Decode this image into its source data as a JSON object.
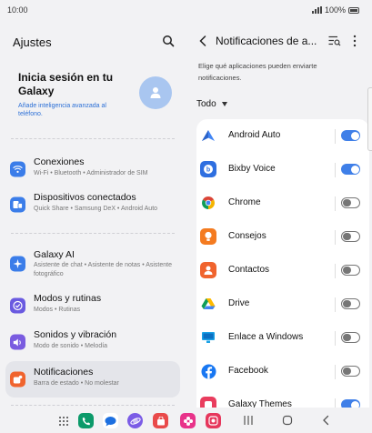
{
  "status": {
    "time": "10:00",
    "battery": "100%"
  },
  "left": {
    "title": "Ajustes",
    "account": {
      "title": "Inicia sesión en tu Galaxy",
      "subtitle": "Añade inteligencia avanzada al teléfono."
    },
    "items": [
      {
        "title": "Conexiones",
        "subtitle": "Wi-Fi  •  Bluetooth  •  Administrador de SIM",
        "icon": "wifi-icon",
        "color": "#3b7de9"
      },
      {
        "title": "Dispositivos conectados",
        "subtitle": "Quick Share  •  Samsung DeX  •  Android Auto",
        "icon": "devices-icon",
        "color": "#3b7de9"
      },
      {
        "title": "Galaxy AI",
        "subtitle": "Asistente de chat  •  Asistente de notas  •  Asistente fotográfico",
        "icon": "sparkle-icon",
        "color": "#3b7de9"
      },
      {
        "title": "Modos y rutinas",
        "subtitle": "Modos  •  Rutinas",
        "icon": "check-circle-icon",
        "color": "#6a5ae0"
      },
      {
        "title": "Sonidos y vibración",
        "subtitle": "Modo de sonido  •  Melodía",
        "icon": "volume-icon",
        "color": "#7a5ce0"
      },
      {
        "title": "Notificaciones",
        "subtitle": "Barra de estado  •  No molestar",
        "icon": "bell-icon",
        "color": "#f0642e"
      }
    ]
  },
  "right": {
    "title": "Notificaciones de a...",
    "description": "Elige qué aplicaciones pueden enviarte notificaciones.",
    "filter": "Todo",
    "apps": [
      {
        "name": "Android Auto",
        "on": true,
        "icon": "android-auto-icon",
        "color": "#ffffff"
      },
      {
        "name": "Bixby Voice",
        "on": true,
        "icon": "bixby-icon",
        "color": "#2f6fe0"
      },
      {
        "name": "Chrome",
        "on": false,
        "icon": "chrome-icon",
        "color": "#ffffff"
      },
      {
        "name": "Consejos",
        "on": false,
        "icon": "tips-icon",
        "color": "#f47b20"
      },
      {
        "name": "Contactos",
        "on": false,
        "icon": "contacts-icon",
        "color": "#f0642e"
      },
      {
        "name": "Drive",
        "on": false,
        "icon": "drive-icon",
        "color": "#ffffff"
      },
      {
        "name": "Enlace a Windows",
        "on": false,
        "icon": "windows-link-icon",
        "color": "#ffffff"
      },
      {
        "name": "Facebook",
        "on": false,
        "icon": "facebook-icon",
        "color": "#1877f2"
      },
      {
        "name": "Galaxy Themes",
        "on": true,
        "icon": "themes-icon",
        "color": "#e93d5e"
      }
    ]
  },
  "navbar": {
    "apps": [
      {
        "icon": "app-drawer-icon",
        "color": "#f2f2f4"
      },
      {
        "icon": "phone-icon",
        "color": "#0c9a6a"
      },
      {
        "icon": "messages-icon",
        "color": "#ffffff"
      },
      {
        "icon": "internet-icon",
        "color": "#7b5ce6"
      },
      {
        "icon": "store-icon",
        "color": "#e94a4a"
      },
      {
        "icon": "gallery-icon",
        "color": "#e8338a"
      },
      {
        "icon": "camera-icon",
        "color": "#e6375c"
      }
    ]
  }
}
